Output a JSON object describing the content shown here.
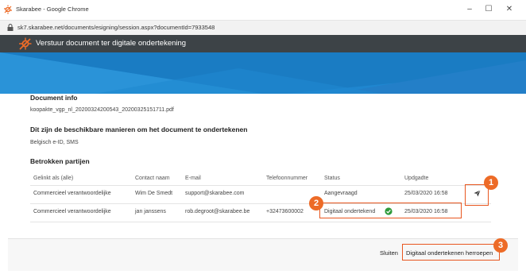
{
  "window": {
    "title": "Skarabee - Google Chrome",
    "minimize": "–",
    "maximize": "☐",
    "close": "✕"
  },
  "address_bar": {
    "url": "sk7.skarabee.net/documents/esigning/session.aspx?documentId=7933548"
  },
  "app": {
    "title": "Verstuur document ter digitale ondertekening"
  },
  "document_info": {
    "heading": "Document info",
    "filename": "koopakte_vgp_nl_20200324200543_20200325151711.pdf"
  },
  "methods": {
    "heading": "Dit zijn de beschikbare manieren om het document te ondertekenen",
    "value": "Belgisch e-ID, SMS"
  },
  "parties": {
    "heading": "Betrokken partijen",
    "columns": [
      "Gelinkt als (alle)",
      "Contact naam",
      "E-mail",
      "Telefoonnummer",
      "Status",
      "Updgadte"
    ],
    "rows": [
      {
        "linked_as": "Commercieel verantwoordelijke",
        "contact": "Wim De Smedt",
        "email": "support@skarabee.com",
        "phone": "",
        "status": "Aangevraagd",
        "updated": "25/03/2020 16:58"
      },
      {
        "linked_as": "Commercieel verantwoordelijke",
        "contact": "jan janssens",
        "email": "rob.degroot@skarabee.be",
        "phone": "+32473600002",
        "status": "Digitaal ondertekend",
        "updated": "25/03/2020 16:58"
      }
    ]
  },
  "footer": {
    "close_label": "Sluiten",
    "revoke_label": "Digitaal ondertekenen herroepen"
  },
  "annotations": [
    "1",
    "2",
    "3"
  ],
  "colors": {
    "accent": "#ed6b27",
    "header": "#3d4347",
    "banner": "#1f86cf",
    "status_ok": "#2e9a3a"
  }
}
